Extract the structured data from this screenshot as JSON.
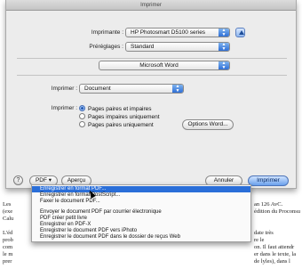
{
  "window": {
    "title": "Imprimer"
  },
  "printer": {
    "label": "Imprimante :",
    "value": "HP Photosmart D5100 series"
  },
  "presets": {
    "label": "Préréglages :",
    "value": "Standard"
  },
  "app_popup": {
    "value": "Microsoft Word"
  },
  "print_what": {
    "label": "Imprimer :",
    "value": "Document"
  },
  "pages": {
    "label": "Imprimer :",
    "options": [
      "Pages paires et impaires",
      "Pages impaires uniquement",
      "Pages paires uniquement"
    ],
    "selected_index": 0,
    "word_options_label": "Options Word..."
  },
  "footer": {
    "help_glyph": "?",
    "pdf_label": "PDF ▾",
    "preview_label": "Aperçu",
    "cancel_label": "Annuler",
    "print_label": "Imprimer"
  },
  "pdf_menu": {
    "items": [
      "Enregistrer en format PDF...",
      "Enregistrer en format PostScript...",
      "Faxer le document PDF...",
      "",
      "Envoyer le document PDF par courrier électronique",
      "PDF créer petit livre",
      "Enregistrer en PDF-X",
      "Enregistrer le document PDF vers iPhoto",
      "Enregistrer le document PDF dans le dossier de reçus Web"
    ],
    "highlighted_index": 0
  },
  "background_doc": {
    "left_lines": [
      "Les",
      "(exe",
      "Calu",
      "",
      "L'éd",
      "prob",
      "com",
      "le m",
      "prer"
    ],
    "right_lines": [
      "an 126 AvC.",
      "édition du Proconsu",
      "",
      "date très",
      "re le",
      "on. Il faut attendr",
      "er dans le texte, la",
      "de lyles), dans l"
    ]
  },
  "colors": {
    "accent": "#2a6ed8",
    "sheet_bg": "#ececec"
  }
}
